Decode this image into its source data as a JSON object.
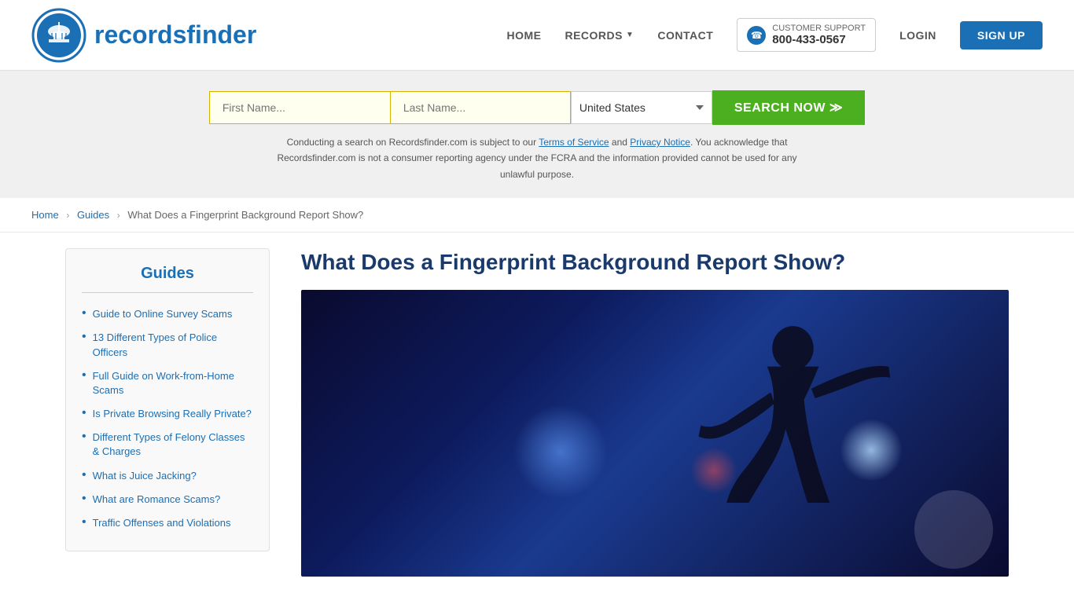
{
  "header": {
    "logo_text_regular": "records",
    "logo_text_bold": "finder",
    "nav": {
      "home": "HOME",
      "records": "RECORDS",
      "contact": "CONTACT",
      "support_label": "CUSTOMER SUPPORT",
      "support_number": "800-433-0567",
      "login": "LOGIN",
      "signup": "SIGN UP"
    }
  },
  "search": {
    "first_name_placeholder": "First Name...",
    "last_name_placeholder": "Last Name...",
    "state_value": "United States",
    "button_label": "SEARCH NOW ≫",
    "disclaimer": "Conducting a search on Recordsfinder.com is subject to our Terms of Service and Privacy Notice. You acknowledge that Recordsfinder.com is not a consumer reporting agency under the FCRA and the information provided cannot be used for any unlawful purpose."
  },
  "breadcrumb": {
    "home": "Home",
    "guides": "Guides",
    "current": "What Does a Fingerprint Background Report Show?"
  },
  "sidebar": {
    "title": "Guides",
    "items": [
      {
        "label": "Guide to Online Survey Scams",
        "href": "#"
      },
      {
        "label": "13 Different Types of Police Officers",
        "href": "#"
      },
      {
        "label": "Full Guide on Work-from-Home Scams",
        "href": "#"
      },
      {
        "label": "Is Private Browsing Really Private?",
        "href": "#"
      },
      {
        "label": "Different Types of Felony Classes & Charges",
        "href": "#"
      },
      {
        "label": "What is Juice Jacking?",
        "href": "#"
      },
      {
        "label": "What are Romance Scams?",
        "href": "#"
      },
      {
        "label": "Traffic Offenses and Violations",
        "href": "#"
      }
    ]
  },
  "article": {
    "title": "What Does a Fingerprint Background Report Show?"
  }
}
